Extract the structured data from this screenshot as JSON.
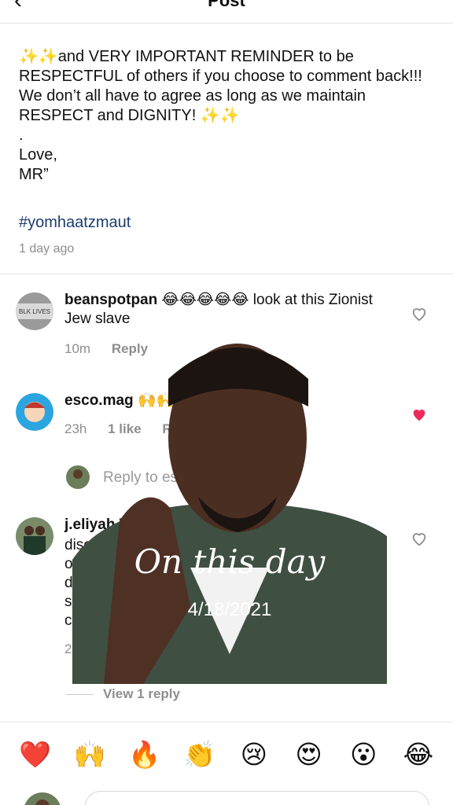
{
  "header": {
    "title": "Post",
    "back_icon": "back-arrow-icon"
  },
  "caption": {
    "text": "✨✨and VERY IMPORTANT REMINDER to be RESPECTFUL of others if you choose to comment back!!! We don’t all have to agree as long as we maintain RESPECT and DIGNITY! ✨✨\n.\nLove,\nMR”",
    "hashtag": "#yomhaatzmaut",
    "time": "1 day ago"
  },
  "comments": [
    {
      "username": "beanspotpan",
      "text": "😂😂😂😂😂 look at this Zionist Jew slave",
      "time": "10m",
      "reply_label": "Reply",
      "liked": false
    },
    {
      "username": "esco.mag",
      "text": "🙌🙌",
      "time": "23h",
      "likes": "1 like",
      "reply_label": "Rep",
      "liked": true
    },
    {
      "username": "j.eliyah",
      "text": "Th",
      "time": "2",
      "liked": false
    }
  ],
  "reply_to_placeholder": "Reply to es",
  "j_eliyah_fragments": [
    "disclai",
    "of fr",
    "de",
    "s",
    "c"
  ],
  "view_replies": "View 1 reply",
  "emoji_bar": [
    "❤️",
    "🙌",
    "🔥",
    "👏",
    "😢",
    "😍",
    "😮",
    "😂"
  ],
  "overlay": {
    "title": "On this day",
    "date": "4/18/2021"
  },
  "colors": {
    "hashtag": "#1c3d6e",
    "heart_red": "#ed2a5a",
    "meta_grey": "#8e8e8e"
  }
}
